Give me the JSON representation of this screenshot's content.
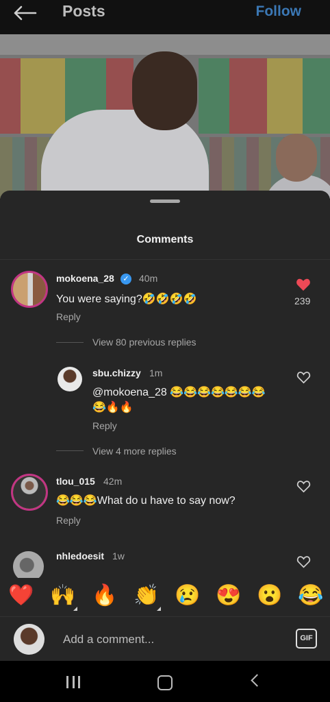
{
  "header": {
    "title": "Posts",
    "follow_label": "Follow"
  },
  "sheet": {
    "title": "Comments"
  },
  "comments": [
    {
      "username": "mokoena_28",
      "time": "40m",
      "text": "You were saying?🤣🤣🤣🤣",
      "reply_label": "Reply",
      "likes": "239",
      "liked": true,
      "view_replies": "View 80 previous replies",
      "replies": [
        {
          "username": "sbu.chizzy",
          "time": "1m",
          "text_line1": "@mokoena_28 😂😂😂😂😂😂😂",
          "text_line2": "😂🔥🔥",
          "reply_label": "Reply"
        }
      ],
      "more_replies": "View 4 more replies"
    },
    {
      "username": "tlou_015",
      "time": "42m",
      "text": "😂😂😂What do u have to say now?",
      "reply_label": "Reply"
    },
    {
      "username": "nhledoesit",
      "time": "1w"
    }
  ],
  "emoji_bar": [
    "❤️",
    "🙌",
    "🔥",
    "👏",
    "😢",
    "😍",
    "😮",
    "😂"
  ],
  "composer": {
    "placeholder": "Add a comment...",
    "gif_label": "GIF"
  },
  "colors": {
    "accent": "#3b78b5",
    "like_red": "#ed4956",
    "sheet_bg": "#262626"
  }
}
